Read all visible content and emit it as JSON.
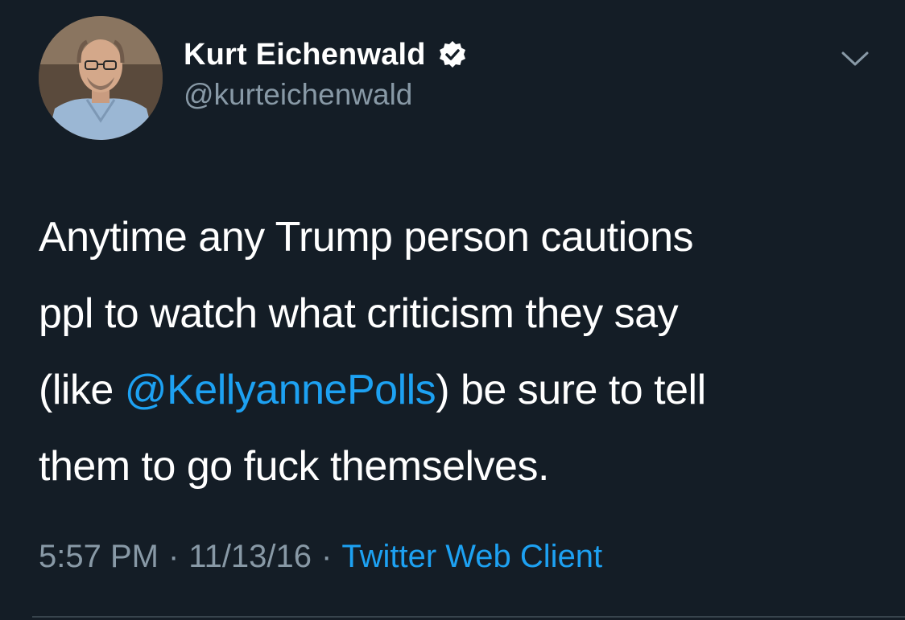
{
  "author": {
    "display_name": "Kurt Eichenwald",
    "handle": "@kurteichenwald",
    "verified_icon": "verified-badge-icon",
    "avatar_icon": "profile-photo"
  },
  "menu": {
    "icon": "chevron-down-icon"
  },
  "tweet": {
    "line1": "Anytime any Trump person cautions",
    "line2": "ppl to watch what criticism they say",
    "line3_before": "(like ",
    "line3_mention": "@KellyannePolls",
    "line3_after": ") be sure to tell",
    "line4": "them to go fuck themselves."
  },
  "meta": {
    "time": "5:57 PM",
    "separator": "·",
    "date": "11/13/16",
    "source": "Twitter Web Client"
  },
  "colors": {
    "background": "#141d26",
    "text": "#ffffff",
    "secondary": "#8899a6",
    "link": "#1da1f2"
  }
}
